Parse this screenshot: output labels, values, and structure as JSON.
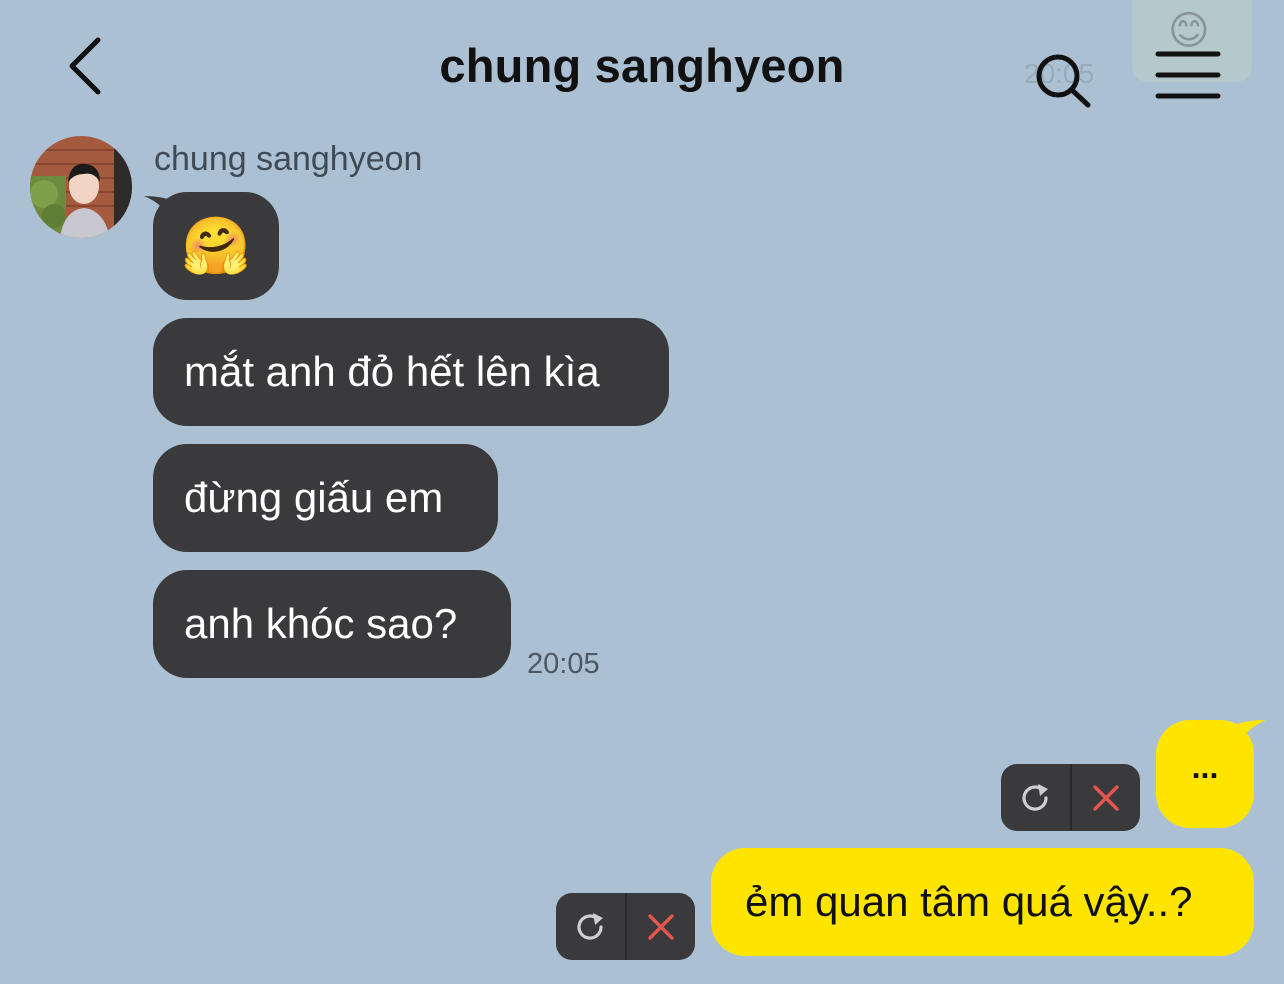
{
  "header": {
    "title": "chung sanghyeon",
    "ghost_time": "20:05"
  },
  "chat": {
    "sender_name": "chung sanghyeon",
    "incoming": [
      {
        "text": "🤗"
      },
      {
        "text": "mắt anh đỏ hết lên kìa"
      },
      {
        "text": "đừng giấu em"
      },
      {
        "text": "anh khóc sao?"
      }
    ],
    "incoming_time": "20:05",
    "outgoing": [
      {
        "text": "..."
      },
      {
        "text": "ẻm quan tâm quá vậy..?"
      }
    ]
  },
  "colors": {
    "background": "#abc1d3",
    "incoming_bubble": "#3a3a3c",
    "outgoing_bubble": "#fee500",
    "delete_icon": "#e5554f"
  },
  "icons": [
    "back-arrow-icon",
    "search-icon",
    "menu-icon",
    "retry-icon",
    "close-icon"
  ]
}
